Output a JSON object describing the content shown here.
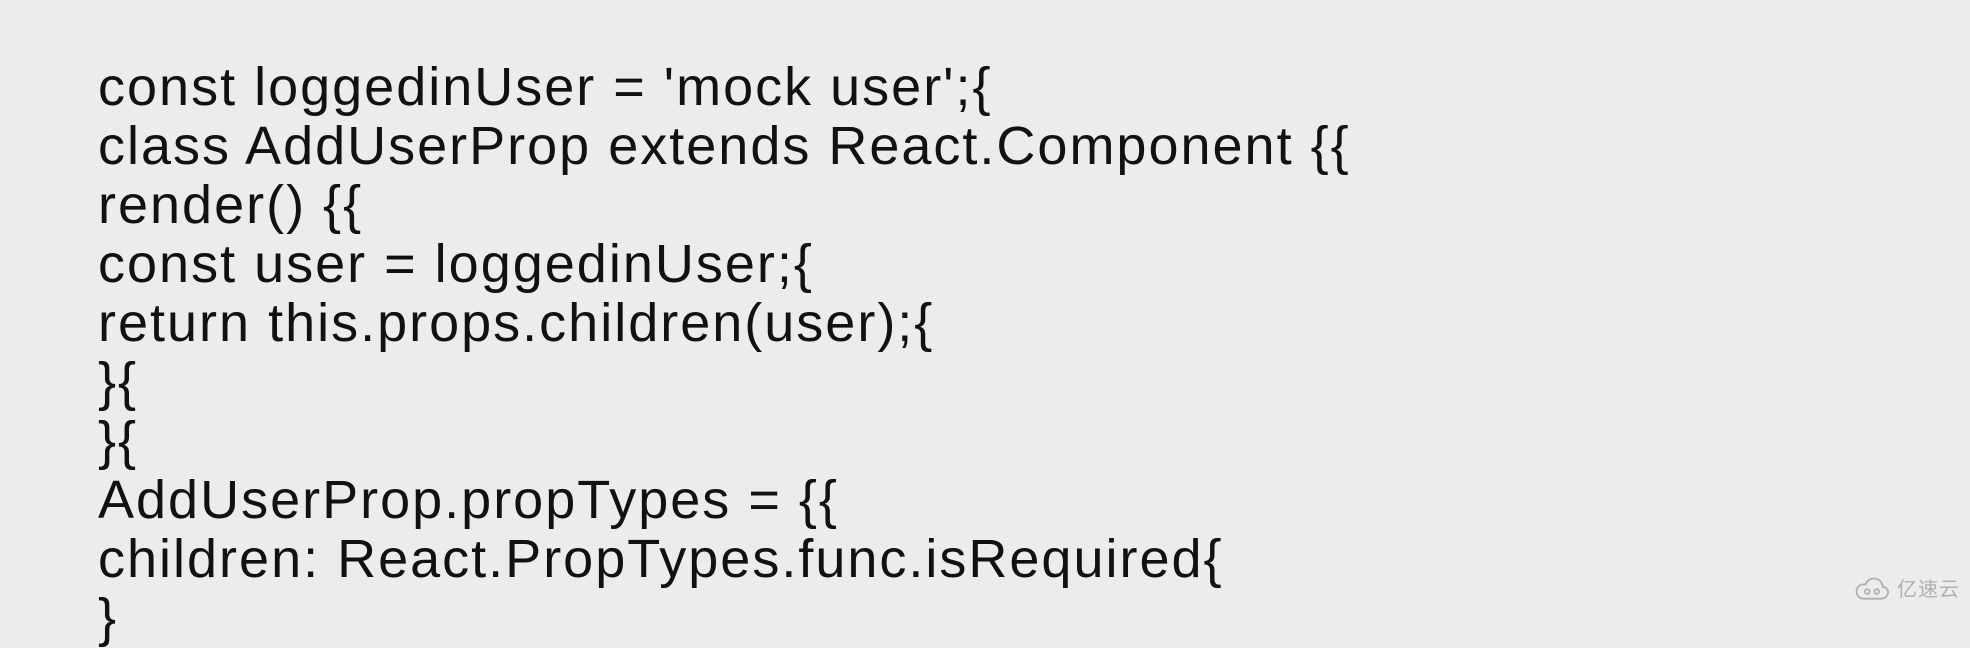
{
  "code": {
    "lines": [
      "const loggedinUser = 'mock user';{",
      "class AddUserProp extends React.Component {{",
      "render() {{",
      "const user = loggedinUser;{",
      "return this.props.children(user);{",
      "}{",
      "}{",
      "AddUserProp.propTypes = {{",
      "children: React.PropTypes.func.isRequired{",
      "}"
    ]
  },
  "watermark": {
    "label": "亿速云"
  }
}
